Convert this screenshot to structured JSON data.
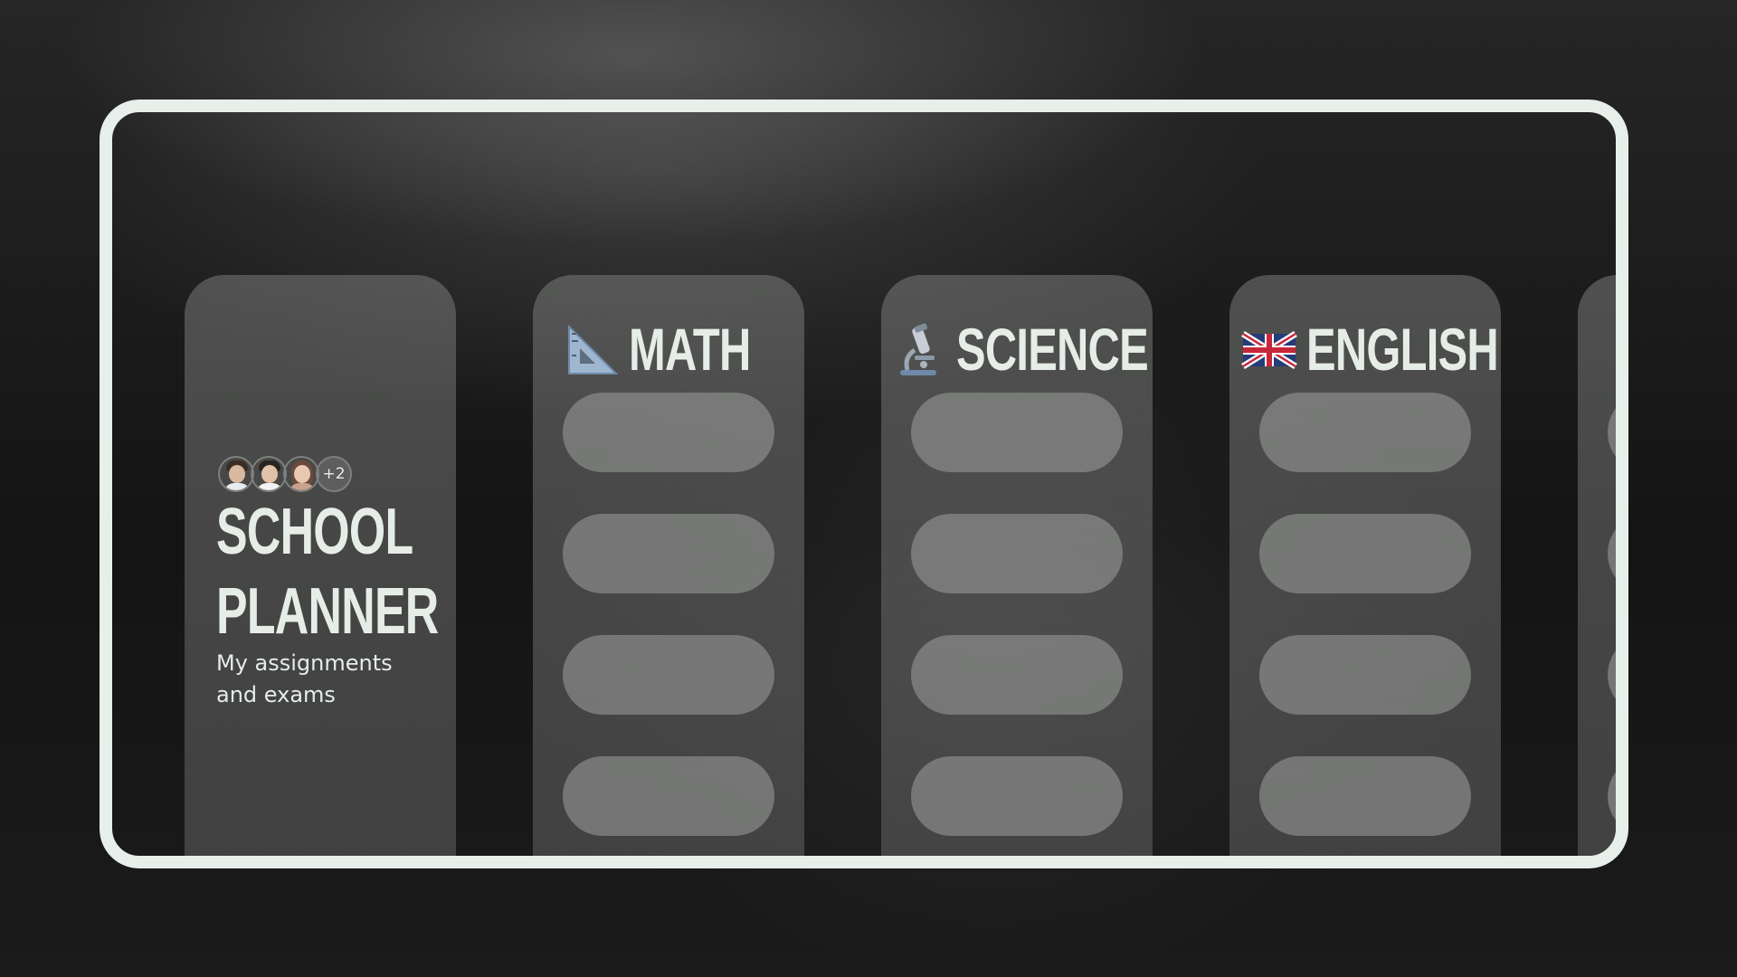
{
  "planner": {
    "title_line1": "SCHOOL",
    "title_line2": "PLANNER",
    "subtitle": "My assignments and exams",
    "avatars_more": "+2"
  },
  "columns": [
    {
      "label": "MATH",
      "icon": "triangle-ruler-icon"
    },
    {
      "label": "SCIENCE",
      "icon": "microscope-icon"
    },
    {
      "label": "ENGLISH",
      "icon": "uk-flag-icon"
    }
  ],
  "colors": {
    "frame_border": "#e6efe9",
    "text": "#e6ede7",
    "card": "#6a6b6a",
    "pill": "#8f908f"
  }
}
